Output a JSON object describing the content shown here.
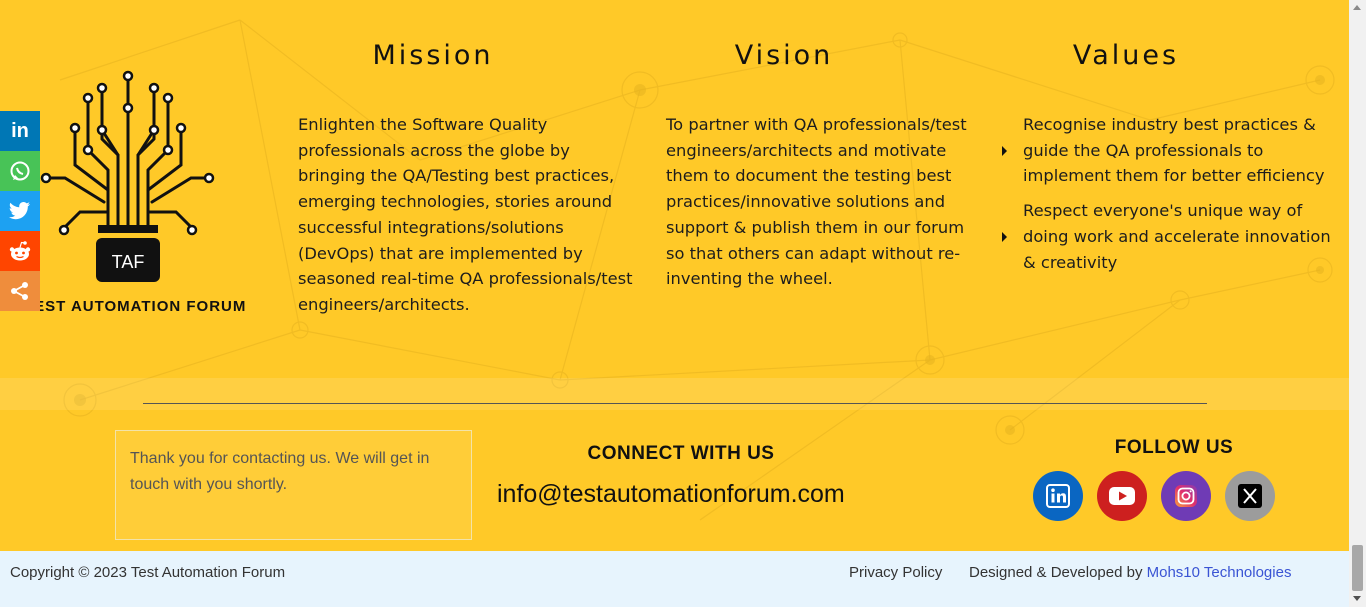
{
  "logo": {
    "badge": "TAF",
    "name": "TEST AUTOMATION FORUM"
  },
  "share": {
    "items": [
      {
        "name": "linkedin",
        "color": "#0077b5"
      },
      {
        "name": "whatsapp",
        "color": "#48c357"
      },
      {
        "name": "twitter",
        "color": "#1da1f2"
      },
      {
        "name": "reddit",
        "color": "#ff4500"
      },
      {
        "name": "share",
        "color": "#ef8d3c"
      }
    ]
  },
  "mission": {
    "title": "Mission",
    "text": "Enlighten the Software Quality professionals across the globe by bringing the QA/Testing best practices, emerging technologies, stories around successful integrations/solutions (DevOps) that are implemented by seasoned real-time QA professionals/test engineers/architects."
  },
  "vision": {
    "title": "Vision",
    "text": "To partner with QA professionals/test engineers/architects and motivate them to document the testing best practices/innovative solutions and support & publish them in our forum so that others can adapt without re-inventing the wheel."
  },
  "values": {
    "title": "Values",
    "items": [
      "Recognise industry best practices & guide the QA professionals to implement them for better efficiency",
      "Respect everyone's unique way of doing work and accelerate innovation & creativity"
    ]
  },
  "contact_message": "Thank you for contacting us. We will get in touch with you shortly.",
  "connect": {
    "title": "CONNECT WITH US",
    "email": "info@testautomationforum.com"
  },
  "follow": {
    "title": "FOLLOW US",
    "items": [
      {
        "name": "linkedin",
        "color": "#0a66c2"
      },
      {
        "name": "youtube",
        "color": "#cd201f"
      },
      {
        "name": "instagram",
        "color": "#6f3bb5"
      },
      {
        "name": "x",
        "color": "#9c9c9c"
      }
    ]
  },
  "footer": {
    "copyright": "Copyright © 2023 Test Automation Forum",
    "privacy": "Privacy Policy",
    "designed_prefix": "Designed & Developed by",
    "designed_by": "Mohs10 Technologies"
  }
}
